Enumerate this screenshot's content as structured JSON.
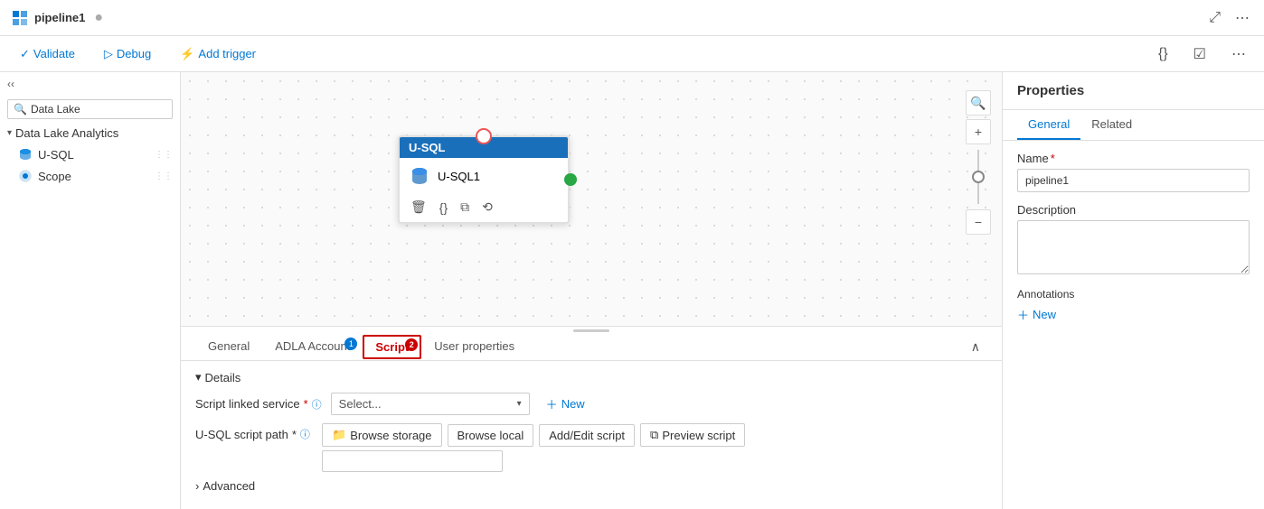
{
  "topbar": {
    "logo": "▦",
    "pipeline_name": "pipeline1",
    "dot": "●",
    "icons": [
      "expand-icon",
      "close-icon"
    ]
  },
  "toolbar": {
    "validate_label": "Validate",
    "debug_label": "Debug",
    "trigger_label": "Add trigger"
  },
  "sidebar": {
    "search_placeholder": "Data Lake",
    "category": "Data Lake Analytics",
    "items": [
      {
        "label": "U-SQL",
        "icon": "usql"
      },
      {
        "label": "Scope",
        "icon": "scope"
      }
    ]
  },
  "canvas": {
    "node": {
      "header": "U-SQL",
      "label": "U-SQL1"
    }
  },
  "bottom_panel": {
    "tabs": [
      {
        "label": "General",
        "active": false,
        "badge": null
      },
      {
        "label": "ADLA Account",
        "active": false,
        "badge": "1"
      },
      {
        "label": "Script",
        "active": true,
        "badge": "2"
      },
      {
        "label": "User properties",
        "active": false,
        "badge": null
      }
    ],
    "details_label": "Details",
    "script_service_label": "Script linked service",
    "script_service_placeholder": "Select...",
    "new_btn_label": "New",
    "usql_path_label": "U-SQL script path",
    "browse_storage_label": "Browse storage",
    "browse_local_label": "Browse local",
    "add_edit_label": "Add/Edit script",
    "preview_label": "Preview script",
    "advanced_label": "Advanced"
  },
  "properties": {
    "title": "Properties",
    "tabs": [
      "General",
      "Related"
    ],
    "name_label": "Name",
    "name_required": "*",
    "name_value": "pipeline1",
    "description_label": "Description",
    "annotations_label": "Annotations",
    "new_annotation_label": "New"
  }
}
